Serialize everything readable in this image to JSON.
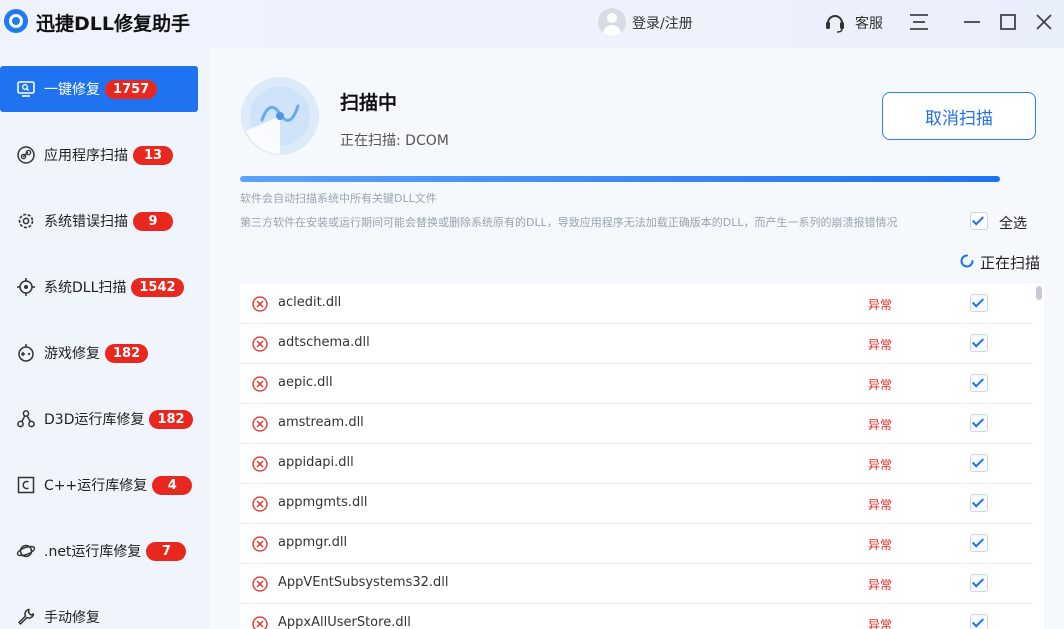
{
  "app": {
    "title": "迅捷DLL修复助手",
    "login_label": "登录/注册",
    "service_label": "客服"
  },
  "sidebar": {
    "items": [
      {
        "label": "一键修复",
        "badge": "1757",
        "icon": "monitor-icon",
        "active": true
      },
      {
        "label": "应用程序扫描",
        "badge": "13",
        "icon": "link-icon"
      },
      {
        "label": "系统错误扫描",
        "badge": "9",
        "icon": "gear-icon"
      },
      {
        "label": "系统DLL扫描",
        "badge": "1542",
        "icon": "target-icon"
      },
      {
        "label": "游戏修复",
        "badge": "182",
        "icon": "gamepad-icon"
      },
      {
        "label": "D3D运行库修复",
        "badge": "182",
        "icon": "nodes-icon"
      },
      {
        "label": "C++运行库修复",
        "badge": "4",
        "icon": "c-icon"
      },
      {
        "label": ".net运行库修复",
        "badge": "7",
        "icon": "planet-icon"
      },
      {
        "label": "手动修复",
        "badge": "",
        "icon": "wrench-icon"
      }
    ]
  },
  "scan": {
    "title": "扫描中",
    "status": "正在扫描: DCOM",
    "cancel_label": "取消扫描",
    "progress": 1.0,
    "hint_line1": "软件会自动扫描系统中所有关键DLL文件",
    "hint_line2": "第三方软件在安装或运行期间可能会替换或删除系统原有的DLL，导致应用程序无法加载正确版本的DLL，而产生一系列的崩溃报错情况",
    "select_all_label": "全选",
    "scanning_label": "正在扫描"
  },
  "dll_list": [
    {
      "name": "acledit.dll",
      "status": "异常",
      "checked": true
    },
    {
      "name": "adtschema.dll",
      "status": "异常",
      "checked": true
    },
    {
      "name": "aepic.dll",
      "status": "异常",
      "checked": true
    },
    {
      "name": "amstream.dll",
      "status": "异常",
      "checked": true
    },
    {
      "name": "appidapi.dll",
      "status": "异常",
      "checked": true
    },
    {
      "name": "appmgmts.dll",
      "status": "异常",
      "checked": true
    },
    {
      "name": "appmgr.dll",
      "status": "异常",
      "checked": true
    },
    {
      "name": "AppVEntSubsystems32.dll",
      "status": "异常",
      "checked": true
    },
    {
      "name": "AppxAllUserStore.dll",
      "status": "异常",
      "checked": true
    }
  ],
  "colors": {
    "accent": "#1f72f0",
    "badge": "#e8271f",
    "error": "#e8271f"
  }
}
